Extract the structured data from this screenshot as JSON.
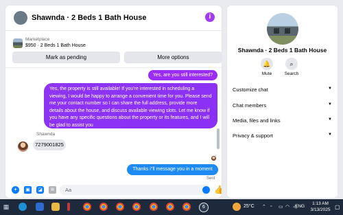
{
  "chat": {
    "title": "Shawnda · 2 Beds 1 Bath House",
    "info_icon": "i"
  },
  "listing": {
    "label": "Marketplace",
    "price_title": "$950 · 2 Beds 1 Bath House",
    "mark_pending": "Mark as pending",
    "more_options": "More options"
  },
  "messages": {
    "out_1": "Yes, are you still interested?",
    "out_2": "Yes, the property is still available! If you're interested in scheduling a viewing, I would be happy to arrange a convenient time for you. Please send me your contact number so I can share the full address, provide more details about the house, and discuss available viewing slots. Let me know if you have any specific questions about the property or its features, and I will be glad to assist you",
    "sender_name": "Shawnda",
    "in_1": "7279001825",
    "out_3": "Thanks i''ll message you in a moment",
    "status": "Sent"
  },
  "composer": {
    "placeholder": "Aa",
    "icons": [
      "plus-icon",
      "image-icon",
      "sticker-icon",
      "gif-icon",
      "emoji-icon",
      "like-icon"
    ]
  },
  "profile": {
    "name": "Shawnda · 2 Beds 1 Bath House",
    "mute_label": "Mute",
    "search_label": "Search",
    "sections": [
      "Customize chat",
      "Chat members",
      "Media, files and links",
      "Privacy & support"
    ]
  },
  "taskbar": {
    "temperature": "25°C",
    "language": "ENG",
    "time": "1:13 AM",
    "date": "3/13/2025"
  },
  "colors": {
    "accent_purple": "#9b2cf4",
    "accent_blue": "#1e8bf5",
    "taskbar": "#1e2a3b"
  }
}
